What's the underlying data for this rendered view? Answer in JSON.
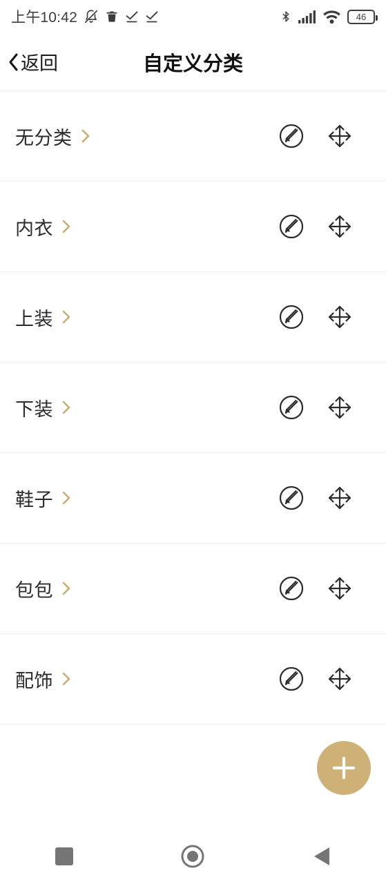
{
  "status_bar": {
    "time": "上午10:42",
    "battery_percent": "46",
    "left_icons": [
      "bell-muted-icon",
      "trash-icon",
      "check-underline-icon",
      "check-underline-icon"
    ],
    "right_icons": [
      "bluetooth-icon",
      "cellular-signal-icon",
      "wifi-icon",
      "battery-icon"
    ]
  },
  "header": {
    "back_label": "返回",
    "title": "自定义分类"
  },
  "colors": {
    "accent_gold": "#cdb177",
    "chevron_gold": "#c9ad6f",
    "divider": "#efefef",
    "text_primary": "#2b2b2b"
  },
  "list": {
    "rows": [
      {
        "label": "无分类",
        "chevron": "chevron-right-icon",
        "edit": "edit-pencil-circle-icon",
        "move": "move-arrows-icon"
      },
      {
        "label": "内衣",
        "chevron": "chevron-right-icon",
        "edit": "edit-pencil-circle-icon",
        "move": "move-arrows-icon"
      },
      {
        "label": "上装",
        "chevron": "chevron-right-icon",
        "edit": "edit-pencil-circle-icon",
        "move": "move-arrows-icon"
      },
      {
        "label": "下装",
        "chevron": "chevron-right-icon",
        "edit": "edit-pencil-circle-icon",
        "move": "move-arrows-icon"
      },
      {
        "label": "鞋子",
        "chevron": "chevron-right-icon",
        "edit": "edit-pencil-circle-icon",
        "move": "move-arrows-icon"
      },
      {
        "label": "包包",
        "chevron": "chevron-right-icon",
        "edit": "edit-pencil-circle-icon",
        "move": "move-arrows-icon"
      },
      {
        "label": "配饰",
        "chevron": "chevron-right-icon",
        "edit": "edit-pencil-circle-icon",
        "move": "move-arrows-icon"
      }
    ]
  },
  "fab": {
    "icon": "plus-icon",
    "label": "+"
  },
  "nav_bar": {
    "recents": "square-icon",
    "home": "circle-icon",
    "back": "triangle-left-icon"
  }
}
